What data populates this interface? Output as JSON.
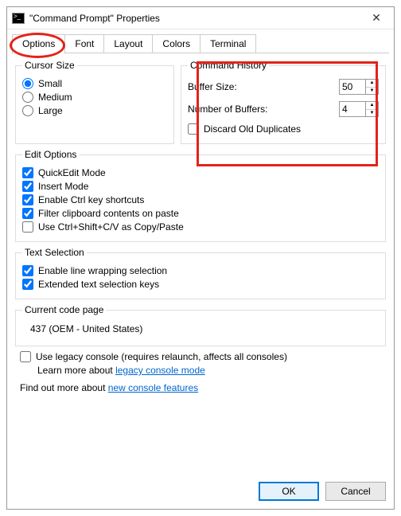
{
  "window": {
    "title": "\"Command Prompt\" Properties"
  },
  "tabs": {
    "options": "Options",
    "font": "Font",
    "layout": "Layout",
    "colors": "Colors",
    "terminal": "Terminal"
  },
  "cursor": {
    "legend": "Cursor Size",
    "small": "Small",
    "medium": "Medium",
    "large": "Large",
    "selected": "small"
  },
  "history": {
    "legend": "Command History",
    "bufferSizeLabel": "Buffer Size:",
    "bufferSize": "50",
    "numBuffersLabel": "Number of Buffers:",
    "numBuffers": "4",
    "discardDupes": "Discard Old Duplicates",
    "discardDupesChecked": false
  },
  "edit": {
    "legend": "Edit Options",
    "quickedit": {
      "label": "QuickEdit Mode",
      "checked": true
    },
    "insert": {
      "label": "Insert Mode",
      "checked": true
    },
    "ctrlshort": {
      "label": "Enable Ctrl key shortcuts",
      "checked": true
    },
    "filterclip": {
      "label": "Filter clipboard contents on paste",
      "checked": true
    },
    "useshiftcv": {
      "label": "Use Ctrl+Shift+C/V as Copy/Paste",
      "checked": false
    }
  },
  "textsel": {
    "legend": "Text Selection",
    "linewrap": {
      "label": "Enable line wrapping selection",
      "checked": true
    },
    "extended": {
      "label": "Extended text selection keys",
      "checked": true
    }
  },
  "codepage": {
    "legend": "Current code page",
    "value": "437   (OEM - United States)"
  },
  "legacy": {
    "label": "Use legacy console (requires relaunch, affects all consoles)",
    "checked": false,
    "learnPrefix": "Learn more about ",
    "learnLink": "legacy console mode"
  },
  "findout": {
    "prefix": "Find out more about ",
    "link": "new console features"
  },
  "buttons": {
    "ok": "OK",
    "cancel": "Cancel"
  }
}
